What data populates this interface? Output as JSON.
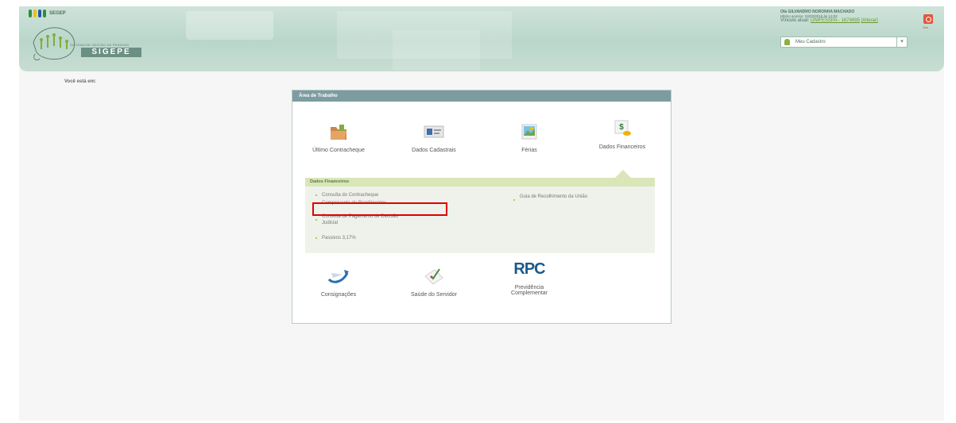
{
  "header": {
    "gov_logo_text": "SEGEP",
    "system_subtitle": "SISTEMA DE GESTÃO DE PESSOAS",
    "system_name": "SIGEPE",
    "user_name": "Olá GILVANDRO NORONHA MACHADO",
    "last_access": "Último acesso: 24/02/2016 às 12:02",
    "vinculo_label": "Vínculo atual:",
    "vinculo_value": "UNIFESSPA - 1674695",
    "vinculo_change": "[Alterar]",
    "exit_label": "Sair",
    "profile_select": "Meu Cadastro"
  },
  "breadcrumb": "Você está em:",
  "panel": {
    "title": "Área de Trabalho",
    "tiles_top": [
      {
        "label": "Último Contracheque",
        "icon": "folder-icon"
      },
      {
        "label": "Dados Cadastrais",
        "icon": "id-card-icon"
      },
      {
        "label": "Férias",
        "icon": "landscape-photo-icon"
      },
      {
        "label": "Dados Financeiros",
        "icon": "money-icon"
      }
    ],
    "submenu": {
      "title": "Dados Financeiros",
      "left_items": [
        "Consulta do Contracheque",
        "Comprovante de Rendimentos",
        "Consulta de Pagamento de Decisão Judicial",
        "Passivos 3,17%"
      ],
      "right_items": [
        "Guia de Recolhimento da União"
      ]
    },
    "tiles_bottom": [
      {
        "label": "Consignações",
        "icon": "plane-arrow-icon"
      },
      {
        "label": "Saúde do Servidor",
        "icon": "checklist-icon"
      },
      {
        "label": "Previdência Complementar",
        "icon": "rpc-icon",
        "icon_text": "RPC"
      }
    ]
  },
  "colors": {
    "header_green": "#b9d6ca",
    "panel_head": "#7d9ca1",
    "submenu_bar": "#d9e6b8",
    "highlight": "#e10000"
  }
}
